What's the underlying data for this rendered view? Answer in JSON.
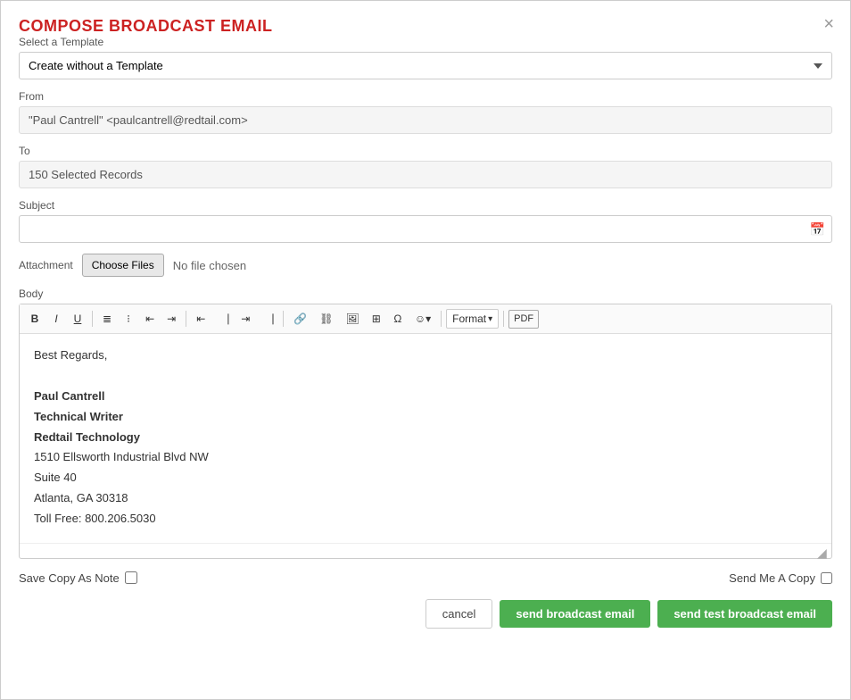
{
  "dialog": {
    "title": "COMPOSE BROADCAST EMAIL",
    "close_icon": "×"
  },
  "template_field": {
    "label": "Select a Template",
    "value": "Create without a Template",
    "options": [
      "Create without a Template"
    ]
  },
  "from_field": {
    "label": "From",
    "value": "\"Paul Cantrell\" <paulcantrell@redtail.com>"
  },
  "to_field": {
    "label": "To",
    "value": "150 Selected Records"
  },
  "subject_field": {
    "label": "Subject",
    "placeholder": ""
  },
  "attachment": {
    "label": "Attachment",
    "choose_files_label": "Choose Files",
    "no_file_text": "No file chosen"
  },
  "body": {
    "label": "Body",
    "toolbar": {
      "bold": "B",
      "italic": "I",
      "underline": "U",
      "format_label": "Format"
    },
    "content_lines": [
      {
        "text": "Best Regards,",
        "bold": false
      },
      {
        "text": "",
        "bold": false
      },
      {
        "text": "Paul Cantrell",
        "bold": true
      },
      {
        "text": "Technical Writer",
        "bold": true
      },
      {
        "text": "Redtail Technology",
        "bold": true
      },
      {
        "text": "1510 Ellsworth Industrial Blvd NW",
        "bold": false
      },
      {
        "text": "Suite 40",
        "bold": false
      },
      {
        "text": "Atlanta, GA 30318",
        "bold": false
      },
      {
        "text": "Toll Free: 800.206.5030",
        "bold": false
      }
    ]
  },
  "save_copy": {
    "label": "Save Copy As Note"
  },
  "send_me_copy": {
    "label": "Send Me A Copy"
  },
  "actions": {
    "cancel_label": "cancel",
    "send_broadcast_label": "send broadcast email",
    "send_test_label": "send test broadcast email"
  }
}
